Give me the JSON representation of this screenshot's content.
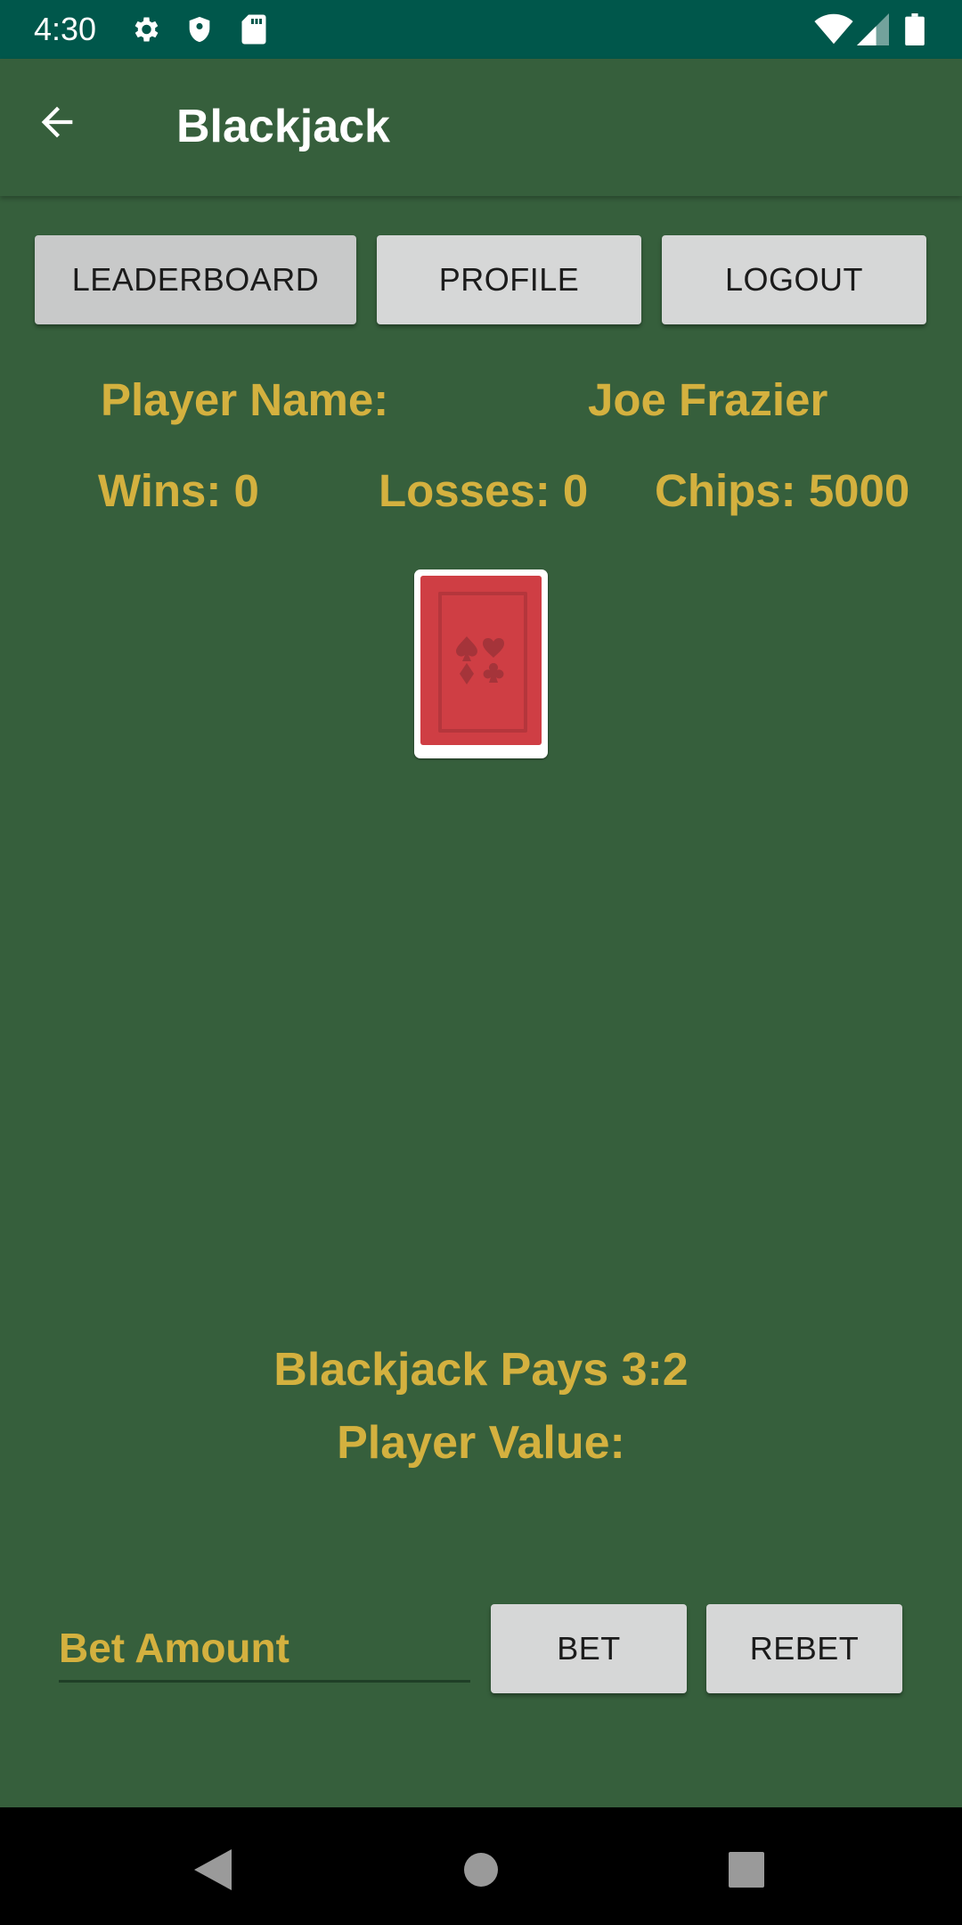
{
  "status_bar": {
    "time": "4:30",
    "icons": [
      "settings-icon",
      "shield-icon",
      "sd-card-icon",
      "wifi-icon",
      "signal-icon",
      "battery-icon"
    ]
  },
  "app_bar": {
    "title": "Blackjack",
    "back_icon": "arrow-back-icon"
  },
  "top_buttons": {
    "leaderboard": "LEADERBOARD",
    "profile": "PROFILE",
    "logout": "LOGOUT"
  },
  "player": {
    "name_label": "Player Name:",
    "name": "Joe Frazier",
    "wins_text": "Wins: 0",
    "losses_text": "Losses: 0",
    "chips_text": "Chips: 5000"
  },
  "table": {
    "card_back_icon": "card-back-icon",
    "pays_text": "Blackjack Pays 3:2",
    "player_value_label": "Player Value:"
  },
  "bet": {
    "placeholder": "Bet Amount",
    "value": "",
    "bet_label": "BET",
    "rebet_label": "REBET"
  },
  "nav_bar": {
    "icons": [
      "back-triangle-icon",
      "home-circle-icon",
      "recents-square-icon"
    ]
  },
  "colors": {
    "background": "#365f3c",
    "status_bar": "#00574b",
    "accent_gold": "#d4b13f",
    "button": "#d6d7d7",
    "card_red": "#cf3e44"
  }
}
